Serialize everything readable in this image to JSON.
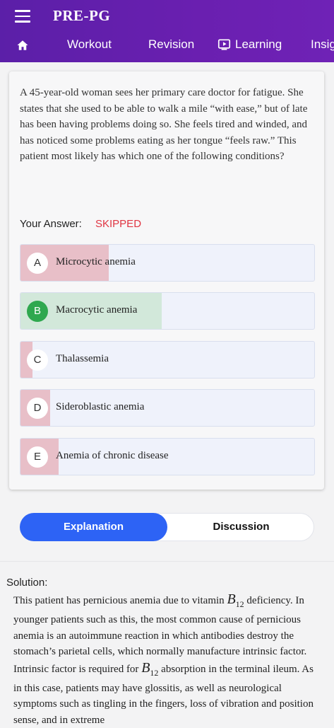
{
  "header": {
    "title": "PRE-PG",
    "nav": {
      "workout": "Workout",
      "revision": "Revision",
      "learning": "Learning",
      "insights": "Insig"
    }
  },
  "question": {
    "text": "A 45-year-old woman sees her primary care doctor for fatigue. She states that she used to be able to walk a mile “with ease,” but of late has been having problems doing so. She feels tired and winded, and has noticed some problems eating as her tongue “feels raw.” This patient most likely has which one of the following conditions?",
    "answer_label": "Your Answer:",
    "answer_status": "SKIPPED",
    "options": [
      {
        "letter": "A",
        "text": "Microcytic anemia",
        "response_fraction": 0.3,
        "correct": false
      },
      {
        "letter": "B",
        "text": "Macrocytic anemia",
        "response_fraction": 0.48,
        "correct": true
      },
      {
        "letter": "C",
        "text": "Thalassemia",
        "response_fraction": 0.04,
        "correct": false
      },
      {
        "letter": "D",
        "text": "Sideroblastic anemia",
        "response_fraction": 0.1,
        "correct": false
      },
      {
        "letter": "E",
        "text": "Anemia of chronic disease",
        "response_fraction": 0.13,
        "correct": false
      }
    ]
  },
  "tabs": {
    "explanation": "Explanation",
    "discussion": "Discussion",
    "active": "explanation"
  },
  "solution": {
    "label": "Solution:",
    "p1": "This patient has pernicious anemia due to vitamin",
    "b": "B",
    "sub": "12",
    "p2": "deficiency. In younger patients such as this, the most common cause of pernicious anemia is an autoimmune reaction in which antibodies destroy the stomach’s parietal cells, which normally manufacture intrinsic factor. Intrinsic factor is required for",
    "p3": "absorption in the terminal ileum. As in this case, patients may have glossitis, as well as neurological symptoms such as tingling in the fingers, loss of vibration and position sense, and in extreme"
  },
  "colors": {
    "header": "#6a1fb0",
    "wrong_fill": "#e8bfc8",
    "correct_fill": "#d2e8da",
    "correct_badge": "#2fa84f",
    "skipped": "#e03542",
    "active_tab": "#2d63f5"
  },
  "icons": {
    "menu": "hamburger-menu-icon",
    "home": "home-icon",
    "learning": "tv-play-icon"
  }
}
